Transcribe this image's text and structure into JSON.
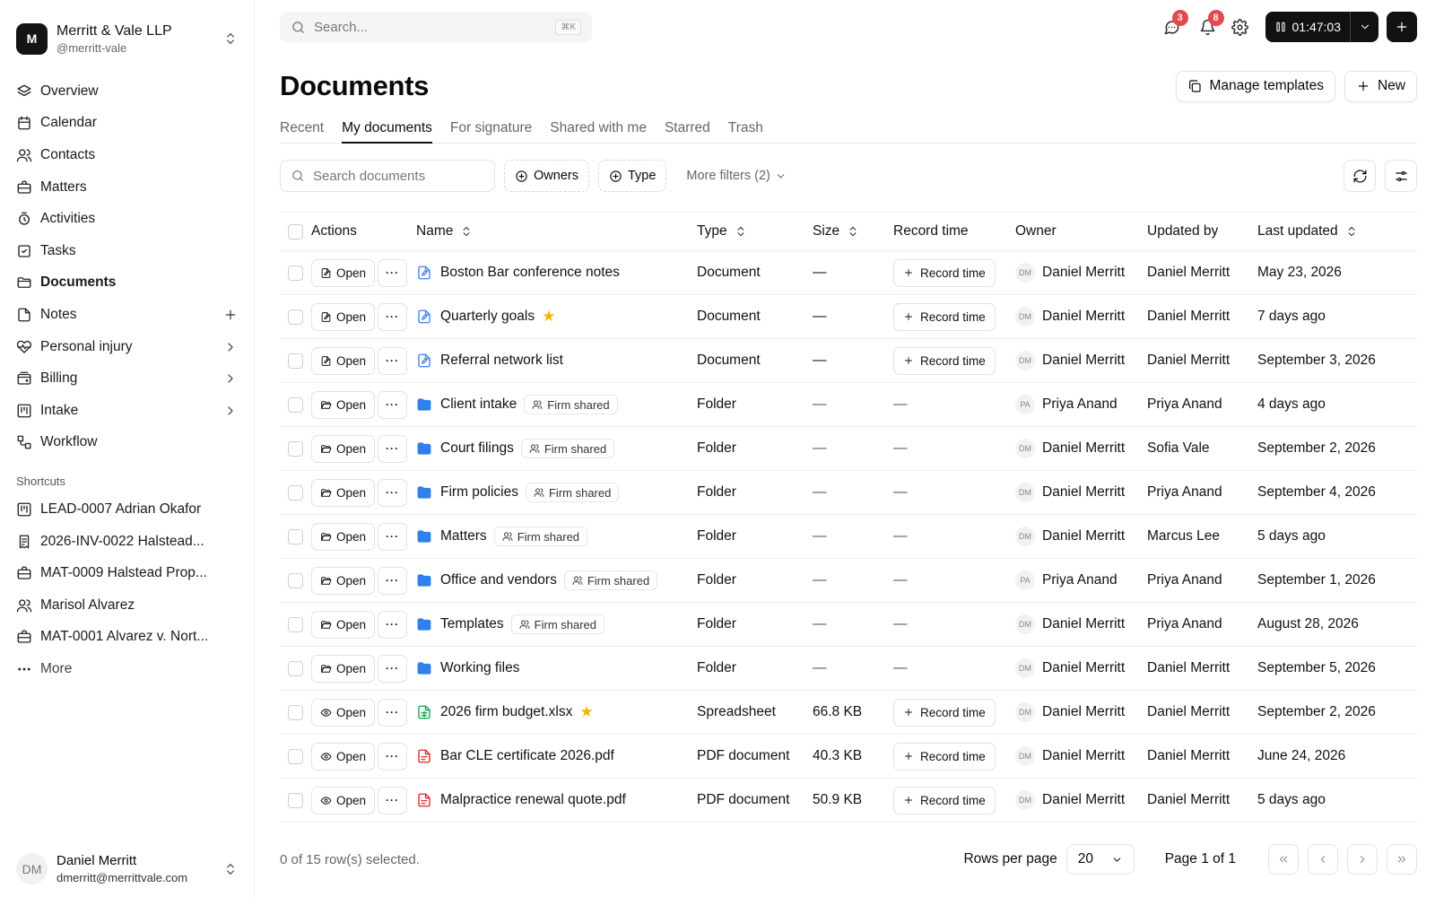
{
  "org": {
    "logo_letter": "M",
    "name": "Merritt & Vale LLP",
    "handle": "@merritt-vale"
  },
  "nav": [
    {
      "label": "Overview",
      "icon": "layers-icon"
    },
    {
      "label": "Calendar",
      "icon": "calendar-icon"
    },
    {
      "label": "Contacts",
      "icon": "users-icon"
    },
    {
      "label": "Matters",
      "icon": "briefcase-icon"
    },
    {
      "label": "Activities",
      "icon": "activity-icon"
    },
    {
      "label": "Tasks",
      "icon": "check-square-icon"
    },
    {
      "label": "Documents",
      "icon": "folder-icon",
      "active": true
    },
    {
      "label": "Notes",
      "icon": "file-icon",
      "trail": "plus"
    },
    {
      "label": "Personal injury",
      "icon": "heart-icon",
      "trail": "chevron"
    },
    {
      "label": "Billing",
      "icon": "wallet-icon",
      "trail": "chevron"
    },
    {
      "label": "Intake",
      "icon": "kanban-icon",
      "trail": "chevron"
    },
    {
      "label": "Workflow",
      "icon": "workflow-icon"
    }
  ],
  "shortcuts": {
    "title": "Shortcuts",
    "items": [
      {
        "label": "LEAD-0007 Adrian Okafor",
        "icon": "kanban-icon"
      },
      {
        "label": "2026-INV-0022 Halstead...",
        "icon": "invoice-icon"
      },
      {
        "label": "MAT-0009 Halstead Prop...",
        "icon": "briefcase-icon"
      },
      {
        "label": "Marisol Alvarez",
        "icon": "users-icon"
      },
      {
        "label": "MAT-0001 Alvarez v. Nort...",
        "icon": "briefcase-icon"
      }
    ],
    "more": "More"
  },
  "user": {
    "initials": "DM",
    "name": "Daniel Merritt",
    "email": "dmerritt@merrittvale.com"
  },
  "topbar": {
    "search_placeholder": "Search...",
    "search_kbd": "⌘K",
    "messages_badge": "3",
    "notifications_badge": "8",
    "timer": "01:47:03"
  },
  "page": {
    "title": "Documents",
    "manage_templates": "Manage templates",
    "new": "New",
    "tabs": [
      "Recent",
      "My documents",
      "For signature",
      "Shared with me",
      "Starred",
      "Trash"
    ],
    "active_tab": 1
  },
  "filters": {
    "search_placeholder": "Search documents",
    "owners": "Owners",
    "type": "Type",
    "more_filters": "More filters (2)"
  },
  "table": {
    "columns": {
      "actions": "Actions",
      "name": "Name",
      "type": "Type",
      "size": "Size",
      "record_time": "Record time",
      "owner": "Owner",
      "updated_by": "Updated by",
      "last_updated": "Last updated"
    },
    "open_label": "Open",
    "record_label": "Record time",
    "shared_label": "Firm shared",
    "rows": [
      {
        "kind": "doc",
        "name": "Boston Bar conference notes",
        "type": "Document",
        "size": "—",
        "record": true,
        "owner_initials": "DM",
        "owner": "Daniel Merritt",
        "updated_by": "Daniel Merritt",
        "last_updated": "May 23, 2026"
      },
      {
        "kind": "doc",
        "name": "Quarterly goals",
        "starred": true,
        "type": "Document",
        "size": "—",
        "record": true,
        "owner_initials": "DM",
        "owner": "Daniel Merritt",
        "updated_by": "Daniel Merritt",
        "last_updated": "7 days ago"
      },
      {
        "kind": "doc",
        "name": "Referral network list",
        "type": "Document",
        "size": "—",
        "record": true,
        "owner_initials": "DM",
        "owner": "Daniel Merritt",
        "updated_by": "Daniel Merritt",
        "last_updated": "September 3, 2026"
      },
      {
        "kind": "folder",
        "name": "Client intake",
        "shared": true,
        "type": "Folder",
        "size": "—",
        "record": false,
        "owner_initials": "PA",
        "owner": "Priya Anand",
        "updated_by": "Priya Anand",
        "last_updated": "4 days ago"
      },
      {
        "kind": "folder",
        "name": "Court filings",
        "shared": true,
        "type": "Folder",
        "size": "—",
        "record": false,
        "owner_initials": "DM",
        "owner": "Daniel Merritt",
        "updated_by": "Sofia Vale",
        "last_updated": "September 2, 2026"
      },
      {
        "kind": "folder",
        "name": "Firm policies",
        "shared": true,
        "type": "Folder",
        "size": "—",
        "record": false,
        "owner_initials": "DM",
        "owner": "Daniel Merritt",
        "updated_by": "Priya Anand",
        "last_updated": "September 4, 2026"
      },
      {
        "kind": "folder",
        "name": "Matters",
        "shared": true,
        "type": "Folder",
        "size": "—",
        "record": false,
        "owner_initials": "DM",
        "owner": "Daniel Merritt",
        "updated_by": "Marcus Lee",
        "last_updated": "5 days ago"
      },
      {
        "kind": "folder",
        "name": "Office and vendors",
        "shared": true,
        "type": "Folder",
        "size": "—",
        "record": false,
        "owner_initials": "PA",
        "owner": "Priya Anand",
        "updated_by": "Priya Anand",
        "last_updated": "September 1, 2026"
      },
      {
        "kind": "folder",
        "name": "Templates",
        "shared": true,
        "type": "Folder",
        "size": "—",
        "record": false,
        "owner_initials": "DM",
        "owner": "Daniel Merritt",
        "updated_by": "Priya Anand",
        "last_updated": "August 28, 2026"
      },
      {
        "kind": "folder",
        "name": "Working files",
        "type": "Folder",
        "size": "—",
        "record": false,
        "owner_initials": "DM",
        "owner": "Daniel Merritt",
        "updated_by": "Daniel Merritt",
        "last_updated": "September 5, 2026"
      },
      {
        "kind": "sheet",
        "name": "2026 firm budget.xlsx",
        "starred": true,
        "type": "Spreadsheet",
        "size": "66.8 KB",
        "record": true,
        "owner_initials": "DM",
        "owner": "Daniel Merritt",
        "updated_by": "Daniel Merritt",
        "last_updated": "September 2, 2026"
      },
      {
        "kind": "pdf",
        "name": "Bar CLE certificate 2026.pdf",
        "type": "PDF document",
        "size": "40.3 KB",
        "record": true,
        "owner_initials": "DM",
        "owner": "Daniel Merritt",
        "updated_by": "Daniel Merritt",
        "last_updated": "June 24, 2026"
      },
      {
        "kind": "pdf",
        "name": "Malpractice renewal quote.pdf",
        "type": "PDF document",
        "size": "50.9 KB",
        "record": true,
        "owner_initials": "DM",
        "owner": "Daniel Merritt",
        "updated_by": "Daniel Merritt",
        "last_updated": "5 days ago"
      }
    ]
  },
  "footer": {
    "selected": "0 of 15 row(s) selected.",
    "rows_per_page_label": "Rows per page",
    "rows_per_page": "20",
    "page_info": "Page 1 of 1"
  },
  "colors": {
    "doc": "#3b82f6",
    "folder": "#2f80ed",
    "sheet": "#16a34a",
    "pdf": "#dc2626",
    "star": "#f5b400",
    "badge": "#e5484d"
  }
}
